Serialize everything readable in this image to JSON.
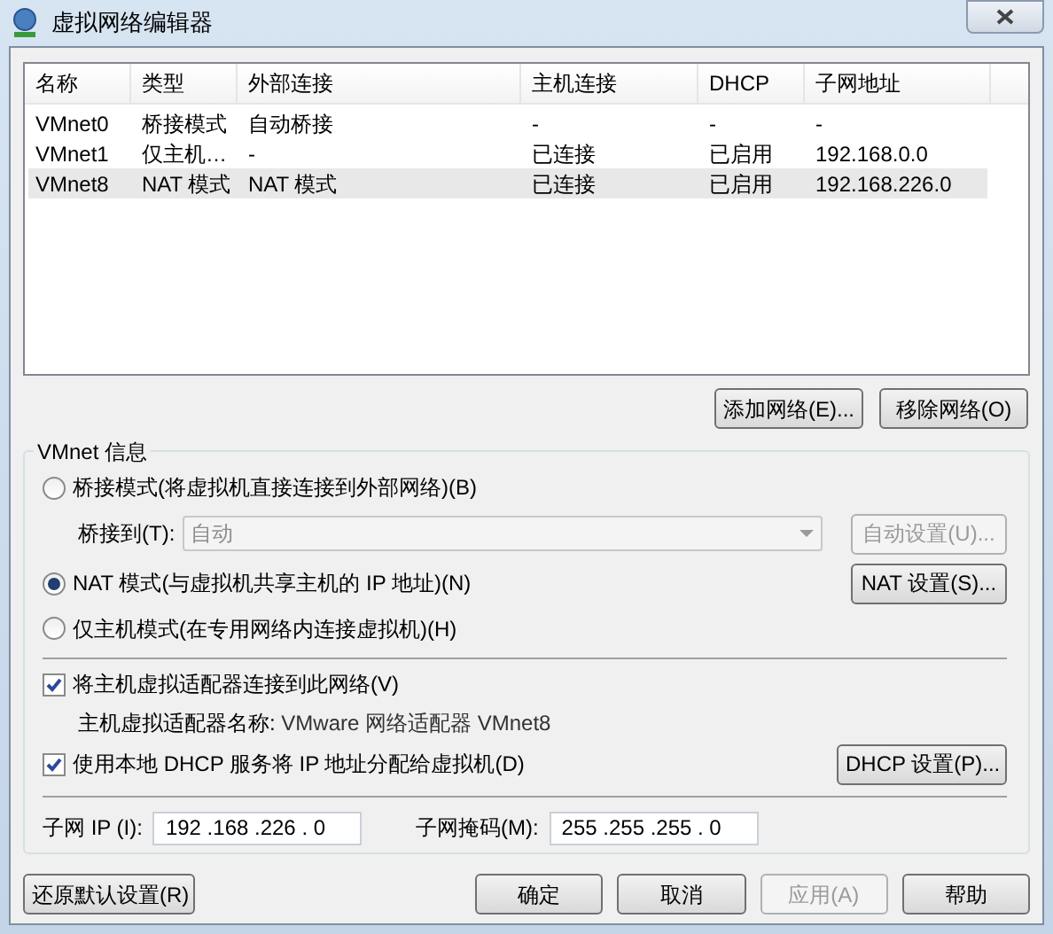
{
  "window": {
    "title": "虚拟网络编辑器"
  },
  "network_table": {
    "columns": [
      "名称",
      "类型",
      "外部连接",
      "主机连接",
      "DHCP",
      "子网地址"
    ],
    "rows": [
      {
        "cells": [
          "VMnet0",
          "桥接模式",
          "自动桥接",
          "-",
          "-",
          "-"
        ],
        "selected": false
      },
      {
        "cells": [
          "VMnet1",
          "仅主机…",
          "-",
          "已连接",
          "已启用",
          "192.168.0.0"
        ],
        "selected": false
      },
      {
        "cells": [
          "VMnet8",
          "NAT 模式",
          "NAT 模式",
          "已连接",
          "已启用",
          "192.168.226.0"
        ],
        "selected": true
      }
    ]
  },
  "table_buttons": [
    "添加网络(E)...",
    "移除网络(O)"
  ],
  "vmnet_info": {
    "title": "VMnet 信息",
    "modes": [
      {
        "label": "桥接模式(将虚拟机直接连接到外部网络)(B)",
        "selected": false
      },
      {
        "label": "NAT 模式(与虚拟机共享主机的 IP 地址)(N)",
        "selected": true
      },
      {
        "label": "仅主机模式(在专用网络内连接虚拟机)(H)",
        "selected": false
      }
    ],
    "bridge_to": {
      "label": "桥接到(T):",
      "value": "自动",
      "disabled": true
    },
    "auto_settings_button": {
      "label": "自动设置(U)...",
      "disabled": true
    },
    "nat_settings_button": {
      "label": "NAT 设置(S)...",
      "disabled": false
    },
    "options": [
      {
        "label": "将主机虚拟适配器连接到此网络(V)",
        "checked": true
      },
      {
        "label": "使用本地 DHCP 服务将 IP 地址分配给虚拟机(D)",
        "checked": true
      }
    ],
    "adapter_name": {
      "label": "主机虚拟适配器名称:",
      "value": "VMware 网络适配器 VMnet8"
    },
    "dhcp_settings_button": {
      "label": "DHCP 设置(P)...",
      "disabled": false
    },
    "subnet_ip": {
      "label": "子网 IP (I):",
      "value": "192 .168 .226 . 0"
    },
    "subnet_mask": {
      "label": "子网掩码(M):",
      "value": "255 .255 .255 . 0"
    }
  },
  "footer_buttons": [
    {
      "label": "还原默认设置(R)",
      "disabled": false
    },
    {
      "label": "确定",
      "disabled": false
    },
    {
      "label": "取消",
      "disabled": false
    },
    {
      "label": "应用(A)",
      "disabled": true
    },
    {
      "label": "帮助",
      "disabled": false
    }
  ]
}
